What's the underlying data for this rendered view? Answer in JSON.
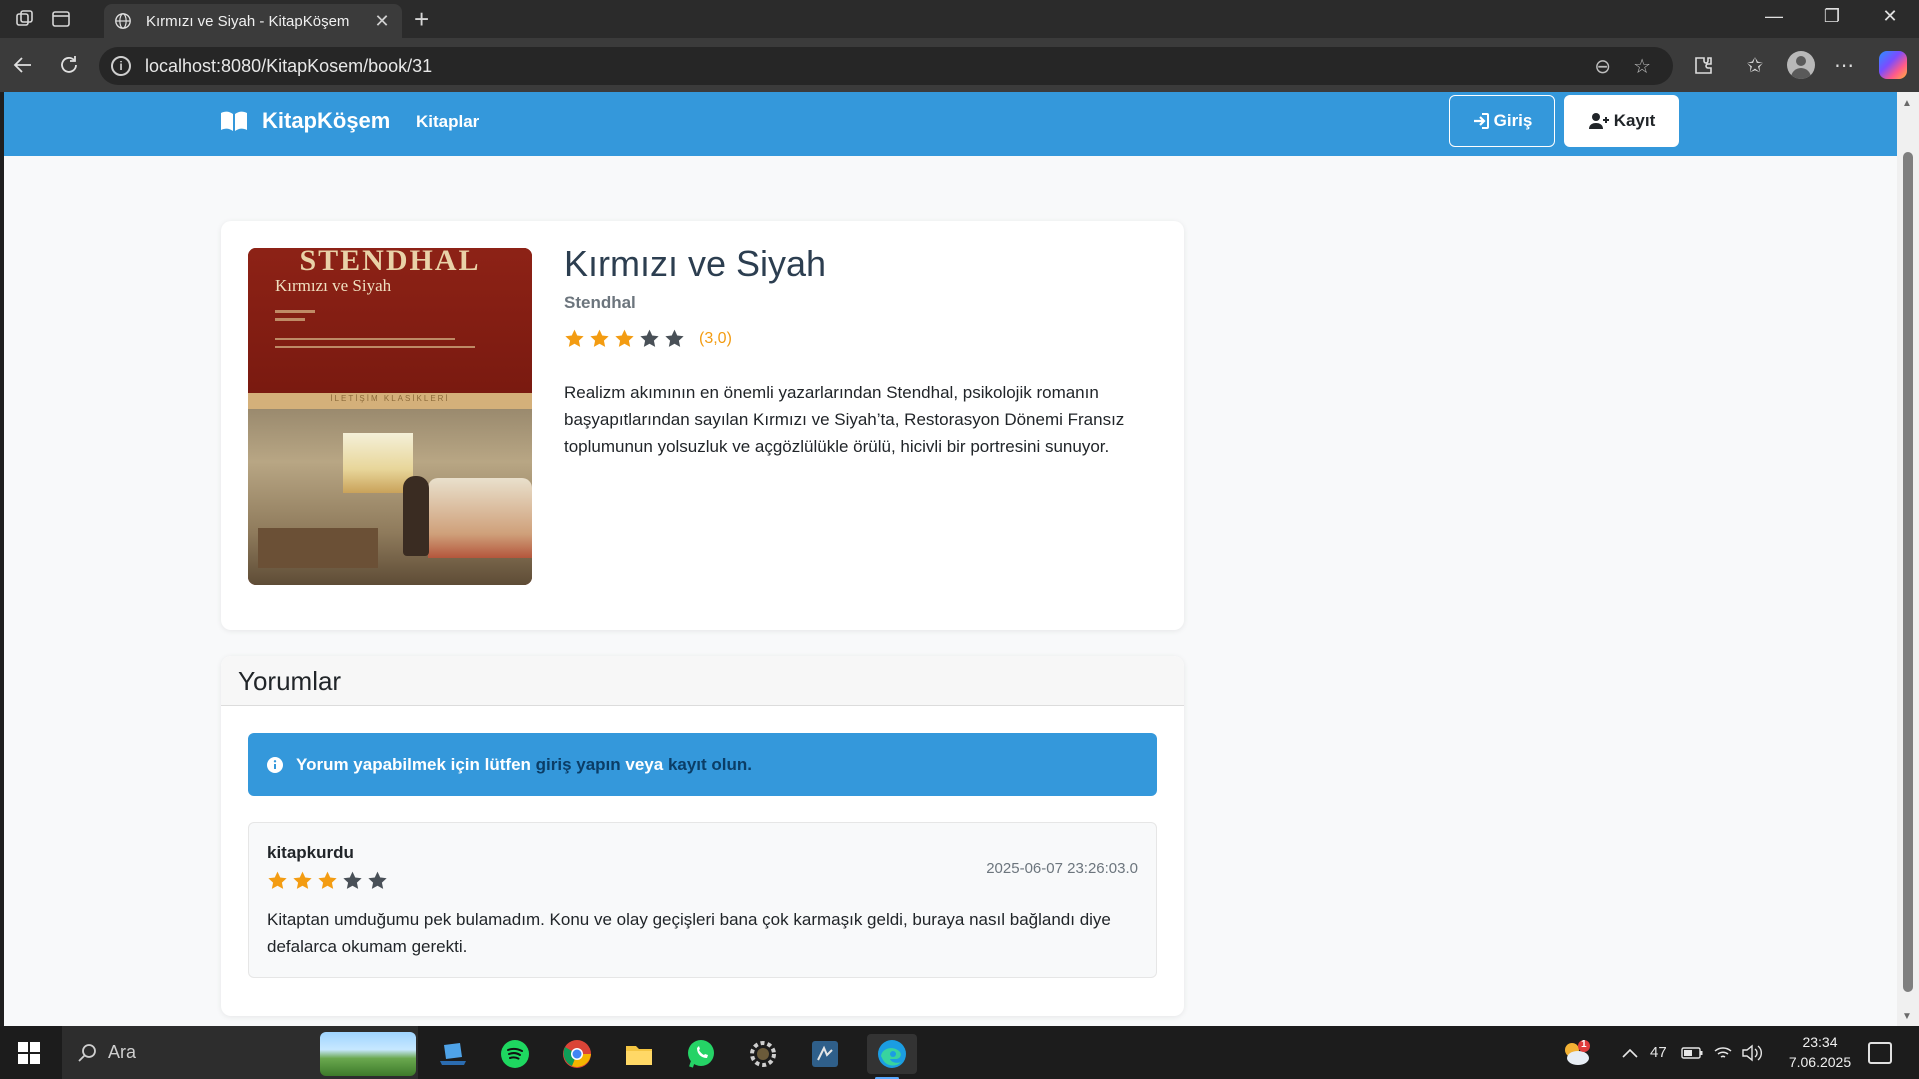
{
  "browser": {
    "tab_title": "Kırmızı ve Siyah - KitapKöşem",
    "url": "localhost:8080/KitapKosem/book/31"
  },
  "site": {
    "brand": "KitapKöşem",
    "nav_books": "Kitaplar",
    "login_label": "Giriş",
    "register_label": "Kayıt",
    "accent_color": "#3498db"
  },
  "book": {
    "title": "Kırmızı ve Siyah",
    "author": "Stendhal",
    "rating": 3,
    "rating_max": 5,
    "rating_label": "(3,0)",
    "description": "Realizm akımının en önemli yazarlarından Stendhal, psikolojik romanın başyapıtlarından sayılan Kırmızı ve Siyah’ta, Restorasyon Dönemi Fransız toplumunun yolsuzluk ve açgözlülükle örülü, hicivli bir portresini sunuyor.",
    "cover": {
      "author_text": "STENDHAL",
      "title_text": "Kırmızı ve Siyah",
      "publisher_text": "İLETİŞİM KLASİKLERİ"
    }
  },
  "comments": {
    "heading": "Yorumlar",
    "alert_prefix": "Yorum yapabilmek için lütfen ",
    "alert_login_link": "giriş yapın",
    "alert_middle": " veya ",
    "alert_register_link": "kayıt olun",
    "alert_suffix": ".",
    "items": [
      {
        "user": "kitapkurdu",
        "date": "2025-06-07 23:26:03.0",
        "rating": 3,
        "text": "Kitaptan umduğumu pek bulamadım. Konu ve olay geçişleri bana çok karmaşık geldi, buraya nasıl bağlandı diye defalarca okumam gerekti."
      }
    ]
  },
  "taskbar": {
    "search_placeholder": "Ara",
    "battery": "47",
    "time": "23:34",
    "date": "7.06.2025",
    "weather_badge": "1"
  }
}
